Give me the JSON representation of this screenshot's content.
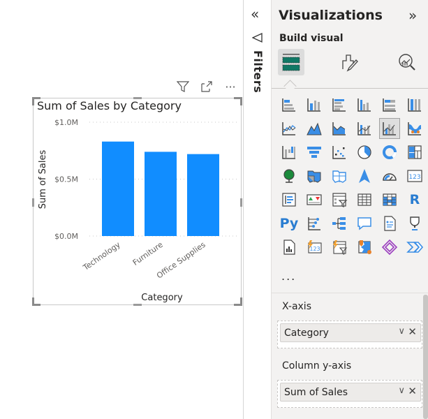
{
  "visual_header": {
    "filter_icon": "filter-icon",
    "focus_icon": "focus-mode-icon",
    "more_icon": "more-options-icon",
    "more_glyph": "···"
  },
  "chart_data": {
    "type": "bar",
    "title": "Sum of Sales by Category",
    "xlabel": "Category",
    "ylabel": "Sum of Sales",
    "categories": [
      "Technology",
      "Furniture",
      "Office Supplies"
    ],
    "values": [
      0.83,
      0.74,
      0.72
    ],
    "value_units": "millions USD",
    "ylim": [
      0,
      1.0
    ],
    "yticks": [
      0,
      0.5,
      1.0
    ],
    "ytick_labels": [
      "$0.0M",
      "$0.5M",
      "$1.0M"
    ],
    "grid": true,
    "bar_color": "#118DFF"
  },
  "filters_pane": {
    "collapse_glyph": "«",
    "label": "Filters"
  },
  "visualizations_pane": {
    "title": "Visualizations",
    "expand_glyph": "»",
    "subtitle": "Build visual",
    "modes": [
      "build-visual",
      "format-visual",
      "analytics"
    ],
    "selected_mode": "build-visual",
    "visual_types": [
      "stacked-bar-chart",
      "stacked-column-chart",
      "clustered-bar-chart",
      "clustered-column-chart",
      "100-stacked-bar-chart",
      "100-stacked-column-chart",
      "line-chart",
      "area-chart",
      "stacked-area-chart",
      "line-and-stacked-column-chart",
      "line-and-clustered-column-chart",
      "ribbon-chart",
      "waterfall-chart",
      "funnel-chart",
      "scatter-chart",
      "pie-chart",
      "donut-chart",
      "treemap",
      "map",
      "filled-map",
      "shape-map",
      "azure-map",
      "gauge",
      "card",
      "multi-row-card",
      "kpi",
      "slicer",
      "table",
      "matrix",
      "r-script-visual",
      "python-visual",
      "key-influencers",
      "decomposition-tree",
      "qa",
      "smart-narrative",
      "goals",
      "paginated-report",
      "metric-card",
      "metric-slicer",
      "arcgis-map",
      "power-apps",
      "power-automate"
    ],
    "selected_visual": "line-and-clustered-column-chart",
    "r_label": "R",
    "py_label": "Py",
    "card_label": "123",
    "more_label": "...",
    "wells": [
      {
        "label": "X-axis",
        "field": "Category"
      },
      {
        "label": "Column y-axis",
        "field": "Sum of Sales"
      }
    ],
    "remove_glyph": "✕",
    "dropdown_glyph": "∨"
  }
}
